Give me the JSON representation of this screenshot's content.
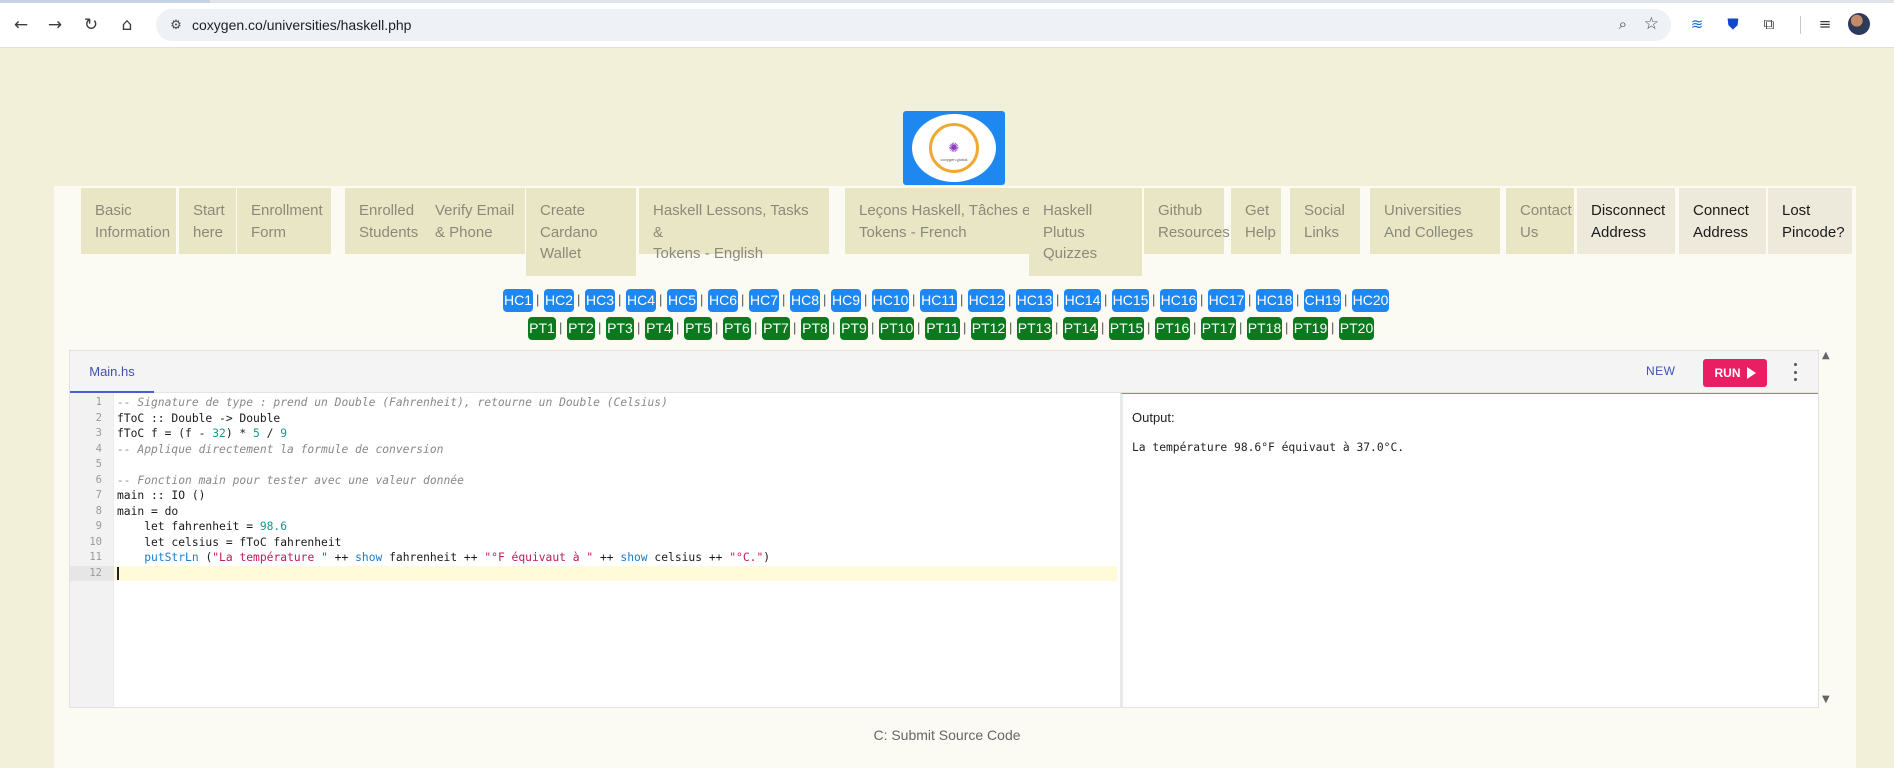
{
  "browser": {
    "url": "coxygen.co/universities/haskell.php"
  },
  "logo": {
    "text": "coxygen.global"
  },
  "menu": [
    {
      "label": "Basic\nInformation",
      "dark": false
    },
    {
      "label": "Start\nhere",
      "dark": false
    },
    {
      "label": "Enrollment\nForm",
      "dark": false
    },
    {
      "label": "Enrolled\nStudents",
      "dark": false
    },
    {
      "label": "Verify Email\n& Phone",
      "dark": false
    },
    {
      "label": "Create\nCardano\nWallet",
      "dark": false
    },
    {
      "label": "Haskell Lessons, Tasks &\nTokens - English",
      "dark": false
    },
    {
      "label": "Leçons Haskell, Tâches et\nTokens - French",
      "dark": false
    },
    {
      "label": "Haskell\nPlutus\nQuizzes",
      "dark": false
    },
    {
      "label": "Github\nResources",
      "dark": false
    },
    {
      "label": "Get\nHelp",
      "dark": false
    },
    {
      "label": "Social\nLinks",
      "dark": false
    },
    {
      "label": "Universities\nAnd Colleges",
      "dark": false
    },
    {
      "label": "Contact\nUs",
      "dark": false
    },
    {
      "label": "Disconnect\nAddress",
      "dark": true
    },
    {
      "label": "Connect\nAddress",
      "dark": true
    },
    {
      "label": "Lost\nPincode?",
      "dark": true
    }
  ],
  "hc_links": [
    "HC1",
    "HC2",
    "HC3",
    "HC4",
    "HC5",
    "HC6",
    "HC7",
    "HC8",
    "HC9",
    "HC10",
    "HC11",
    "HC12",
    "HC13",
    "HC14",
    "HC15",
    "HC16",
    "HC17",
    "HC18",
    "CH19",
    "HC20"
  ],
  "pt_links": [
    "PT1",
    "PT2",
    "PT3",
    "PT4",
    "PT5",
    "PT6",
    "PT7",
    "PT8",
    "PT9",
    "PT10",
    "PT11",
    "PT12",
    "PT13",
    "PT14",
    "PT15",
    "PT16",
    "PT17",
    "PT18",
    "PT19",
    "PT20"
  ],
  "link_separator": "|",
  "editor": {
    "tab": "Main.hs",
    "new_label": "NEW",
    "run_label": "RUN",
    "line_numbers": [
      "1",
      "2",
      "3",
      "4",
      "5",
      "6",
      "7",
      "8",
      "9",
      "10",
      "11",
      "12"
    ],
    "code_lines": [
      [
        {
          "t": "-- Signature de type : prend un Double (Fahrenheit), retourne un Double (Celsius)",
          "c": "cmt"
        }
      ],
      [
        {
          "t": "fToC :: Double -> Double",
          "c": ""
        }
      ],
      [
        {
          "t": "fToC f = (f - ",
          "c": ""
        },
        {
          "t": "32",
          "c": "num"
        },
        {
          "t": ") * ",
          "c": ""
        },
        {
          "t": "5",
          "c": "num"
        },
        {
          "t": " / ",
          "c": ""
        },
        {
          "t": "9",
          "c": "num"
        }
      ],
      [
        {
          "t": "-- Applique directement la formule de conversion",
          "c": "cmt"
        }
      ],
      [],
      [
        {
          "t": "-- Fonction main pour tester avec une valeur donnée",
          "c": "cmt"
        }
      ],
      [
        {
          "t": "main :: IO ()",
          "c": ""
        }
      ],
      [
        {
          "t": "main = do",
          "c": ""
        }
      ],
      [
        {
          "t": "    let fahrenheit = ",
          "c": ""
        },
        {
          "t": "98.6",
          "c": "num"
        }
      ],
      [
        {
          "t": "    let celsius = fToC fahrenheit",
          "c": ""
        }
      ],
      [
        {
          "t": "    ",
          "c": ""
        },
        {
          "t": "putStrLn",
          "c": "fn"
        },
        {
          "t": " (",
          "c": ""
        },
        {
          "t": "\"La température \"",
          "c": "str"
        },
        {
          "t": " ++ ",
          "c": ""
        },
        {
          "t": "show",
          "c": "fn"
        },
        {
          "t": " fahrenheit ++ ",
          "c": ""
        },
        {
          "t": "\"°F équivaut à \"",
          "c": "str"
        },
        {
          "t": " ++ ",
          "c": ""
        },
        {
          "t": "show",
          "c": "fn"
        },
        {
          "t": " celsius ++ ",
          "c": ""
        },
        {
          "t": "\"°C.\"",
          "c": "str"
        },
        {
          "t": ")",
          "c": ""
        }
      ],
      []
    ],
    "active_line": 12,
    "output_label": "Output:",
    "output_text": "La température 98.6°F équivaut à 37.0°C."
  },
  "footer": {
    "submit_label": "C: Submit Source Code"
  },
  "colors": {
    "page_bg": "#f2f0d8",
    "hc_badge": "#1e88f0",
    "pt_badge": "#0b7a1e",
    "run_button": "#e91e63"
  }
}
